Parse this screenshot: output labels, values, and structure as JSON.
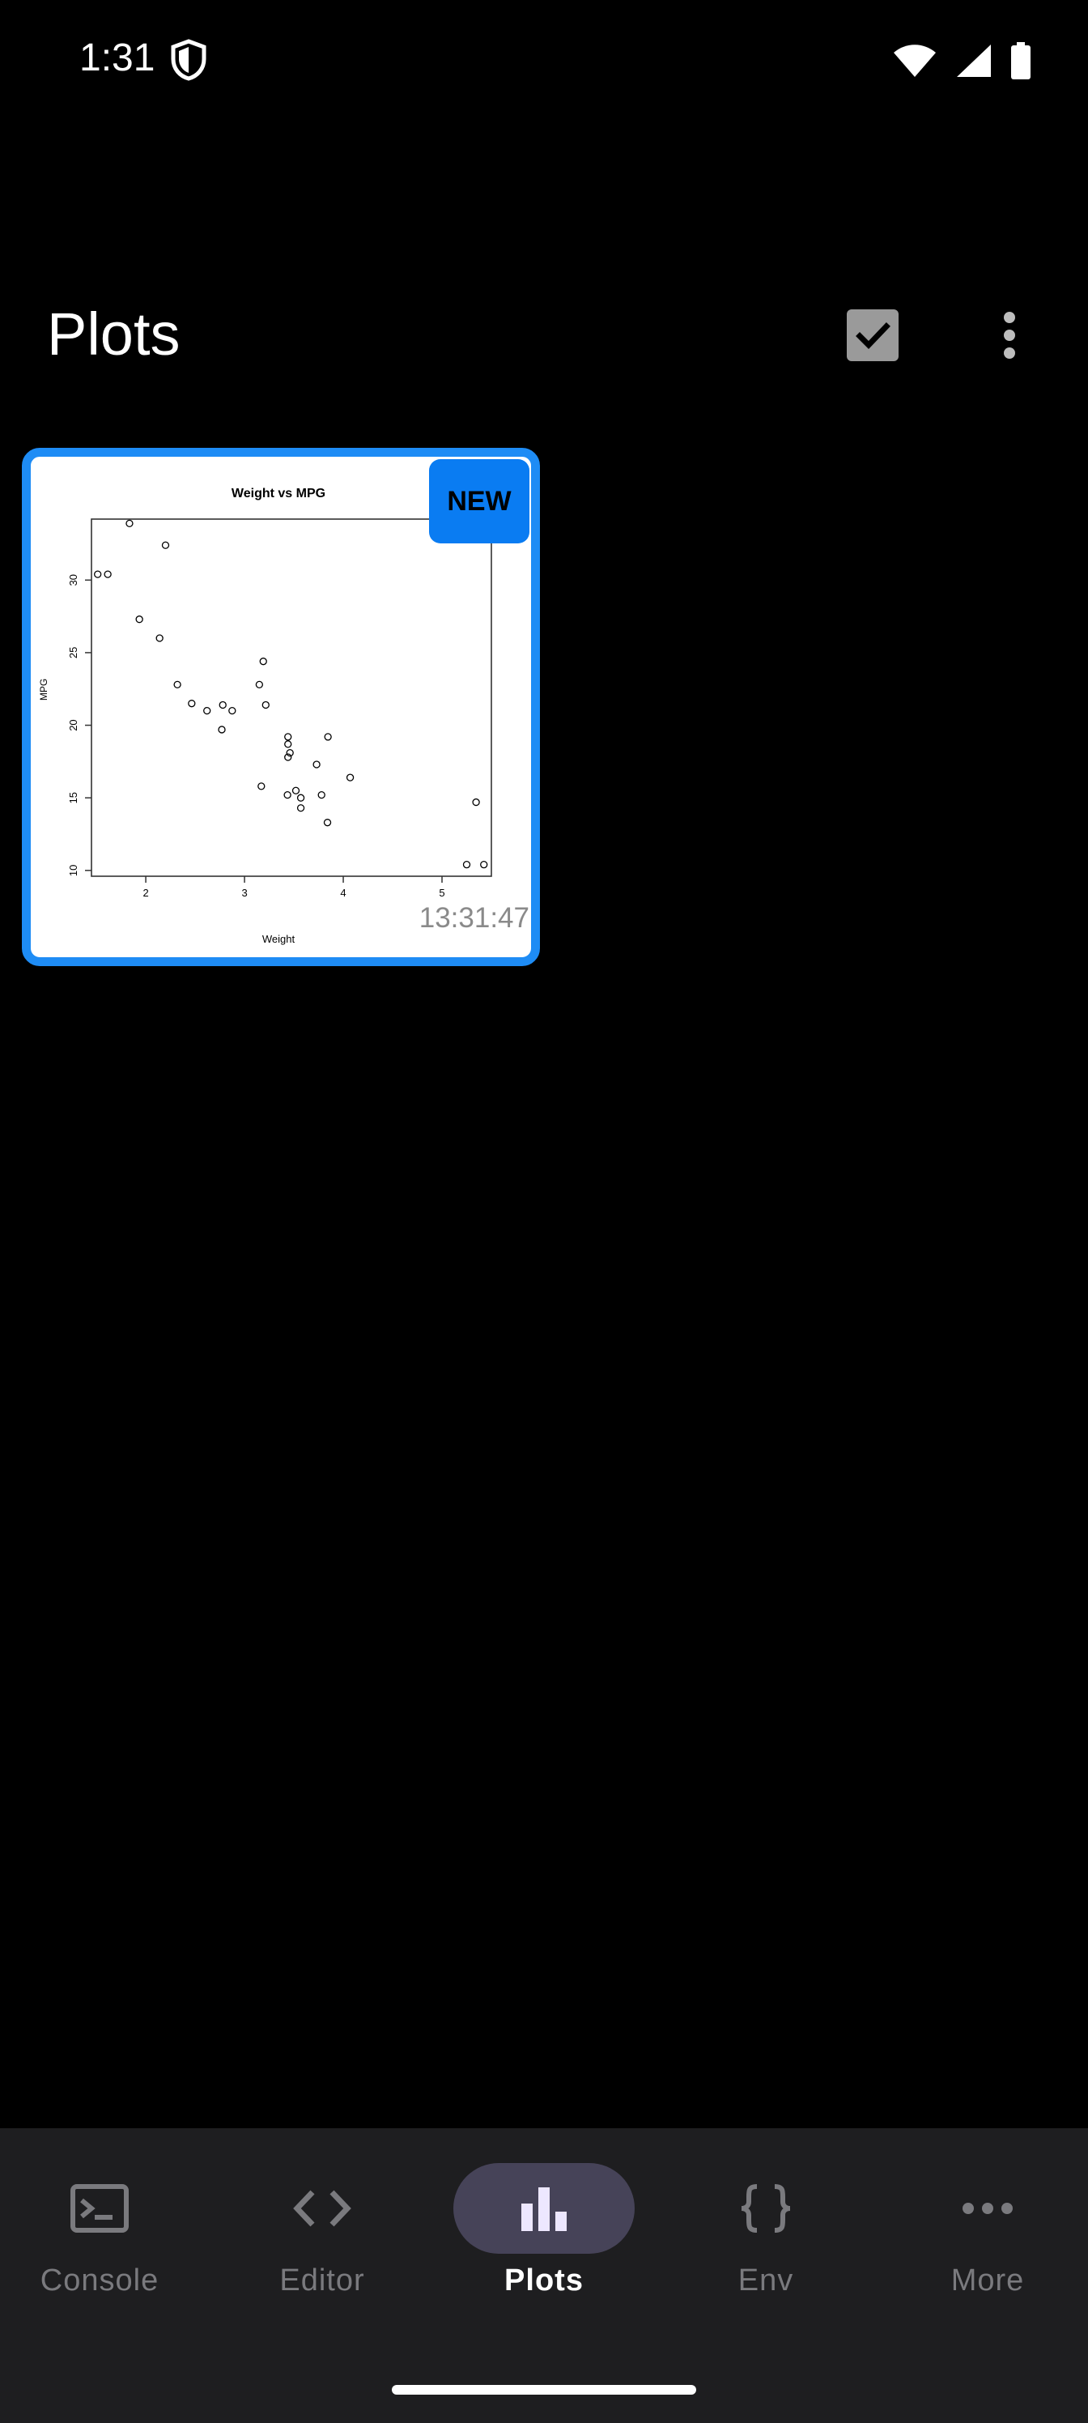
{
  "status_bar": {
    "time": "1:31",
    "icons": [
      "shield-icon",
      "wifi-icon",
      "signal-icon",
      "battery-icon"
    ]
  },
  "app_bar": {
    "title": "Plots",
    "actions": [
      "select-all-checkbox-icon",
      "more-vert-icon"
    ]
  },
  "plots": [
    {
      "badge": "NEW",
      "timestamp": "13:31:47",
      "accent_color": "#1e8cf5",
      "chart_data": {
        "type": "scatter",
        "title": "Weight vs MPG",
        "xlabel": "Weight",
        "ylabel": "MPG",
        "xlim": [
          1.45,
          5.5
        ],
        "ylim": [
          9.6,
          34.2
        ],
        "xticks": [
          "2",
          "3",
          "4",
          "5"
        ],
        "yticks": [
          "10",
          "15",
          "20",
          "25",
          "30"
        ],
        "grid": false,
        "legend": "none",
        "points": [
          {
            "x": 2.62,
            "y": 21.0
          },
          {
            "x": 2.875,
            "y": 21.0
          },
          {
            "x": 2.32,
            "y": 22.8
          },
          {
            "x": 3.215,
            "y": 21.4
          },
          {
            "x": 3.44,
            "y": 18.7
          },
          {
            "x": 3.46,
            "y": 18.1
          },
          {
            "x": 3.57,
            "y": 14.3
          },
          {
            "x": 3.19,
            "y": 24.4
          },
          {
            "x": 3.15,
            "y": 22.8
          },
          {
            "x": 3.44,
            "y": 19.2
          },
          {
            "x": 3.44,
            "y": 17.8
          },
          {
            "x": 4.07,
            "y": 16.4
          },
          {
            "x": 3.73,
            "y": 17.3
          },
          {
            "x": 3.78,
            "y": 15.2
          },
          {
            "x": 5.25,
            "y": 10.4
          },
          {
            "x": 5.424,
            "y": 10.4
          },
          {
            "x": 5.345,
            "y": 14.7
          },
          {
            "x": 2.2,
            "y": 32.4
          },
          {
            "x": 1.615,
            "y": 30.4
          },
          {
            "x": 1.835,
            "y": 33.9
          },
          {
            "x": 2.465,
            "y": 21.5
          },
          {
            "x": 3.52,
            "y": 15.5
          },
          {
            "x": 3.435,
            "y": 15.2
          },
          {
            "x": 3.84,
            "y": 13.3
          },
          {
            "x": 3.845,
            "y": 19.2
          },
          {
            "x": 1.935,
            "y": 27.3
          },
          {
            "x": 2.14,
            "y": 26.0
          },
          {
            "x": 1.513,
            "y": 30.4
          },
          {
            "x": 3.17,
            "y": 15.8
          },
          {
            "x": 2.77,
            "y": 19.7
          },
          {
            "x": 3.57,
            "y": 15.0
          },
          {
            "x": 2.78,
            "y": 21.4
          }
        ]
      }
    }
  ],
  "bottom_nav": {
    "items": [
      {
        "label": "Console",
        "icon": "terminal-icon",
        "active": false
      },
      {
        "label": "Editor",
        "icon": "code-icon",
        "active": false
      },
      {
        "label": "Plots",
        "icon": "bar-chart-icon",
        "active": true
      },
      {
        "label": "Env",
        "icon": "braces-icon",
        "active": false
      },
      {
        "label": "More",
        "icon": "more-horiz-icon",
        "active": false
      }
    ]
  },
  "colors": {
    "background": "#000000",
    "accent": "#1e8cf5",
    "badge": "#0a7cf2",
    "nav_background": "#1e1e20",
    "nav_active_pill": "#464358"
  }
}
